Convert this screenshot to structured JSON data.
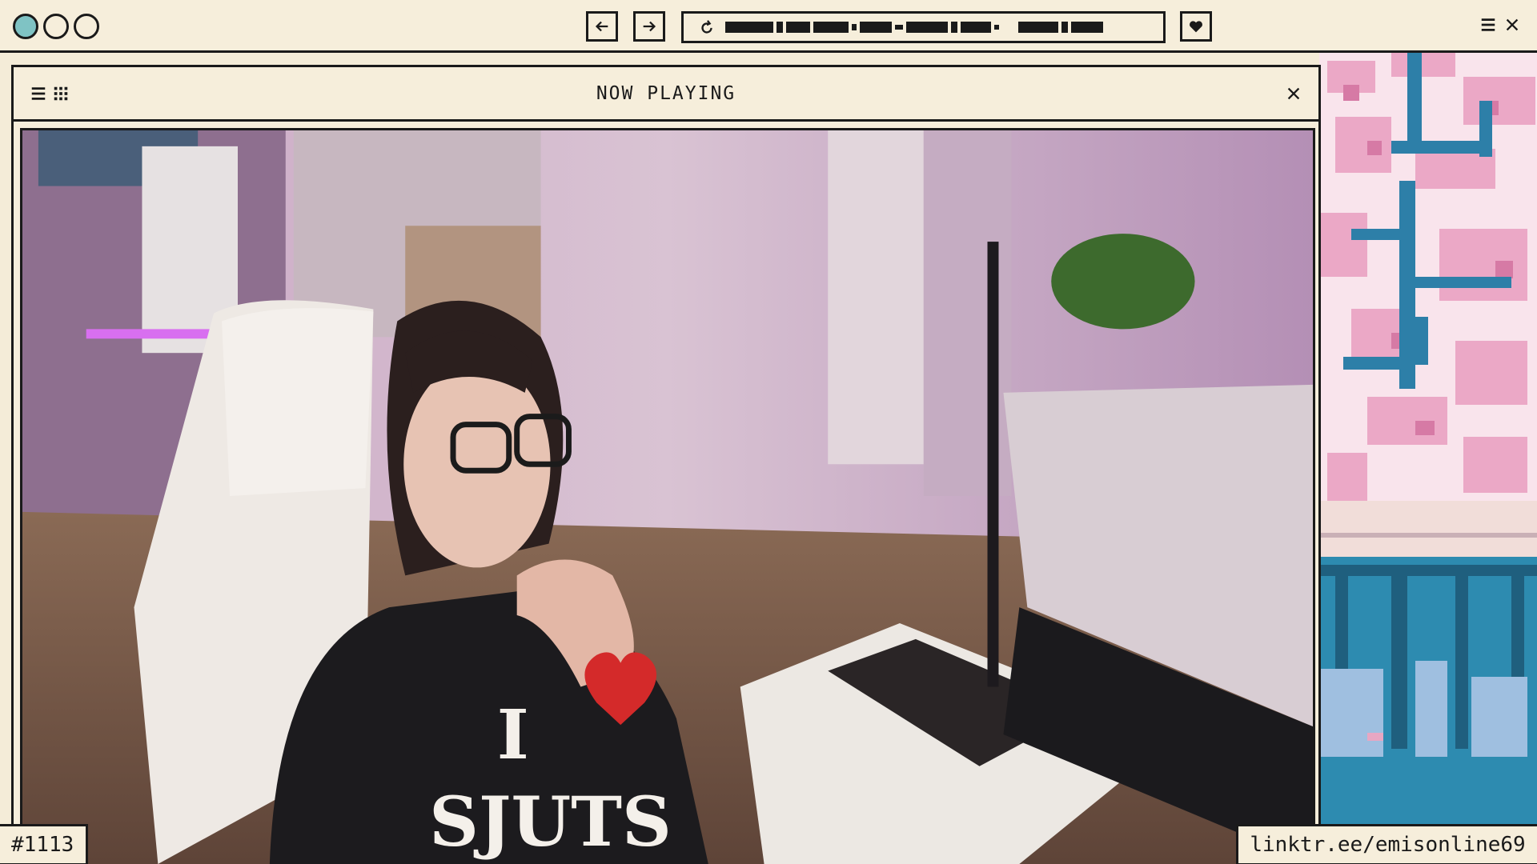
{
  "window": {
    "controls": [
      "circle-teal",
      "circle",
      "circle"
    ],
    "nav": {
      "back_icon": "arrow-left-icon",
      "forward_icon": "arrow-right-icon"
    },
    "address_icon": "refresh-icon",
    "heart_icon": "heart-icon",
    "menu_icon": "hamburger-icon",
    "close_icon": "close-icon"
  },
  "player": {
    "title": "NOW PLAYING",
    "left_icons": [
      "hamburger-icon",
      "grid-icon"
    ],
    "close_icon": "close-icon",
    "shirt_text_top": "I",
    "shirt_text_bottom": "SJUTS"
  },
  "footer": {
    "episode": "#1113",
    "link": "linktr.ee/emisonline69"
  },
  "colors": {
    "cream": "#f6eedb",
    "ink": "#1a1a1a",
    "teal": "#7fc3c4",
    "sakura": "#e7a7c3",
    "branch_blue": "#2d7fa8"
  }
}
